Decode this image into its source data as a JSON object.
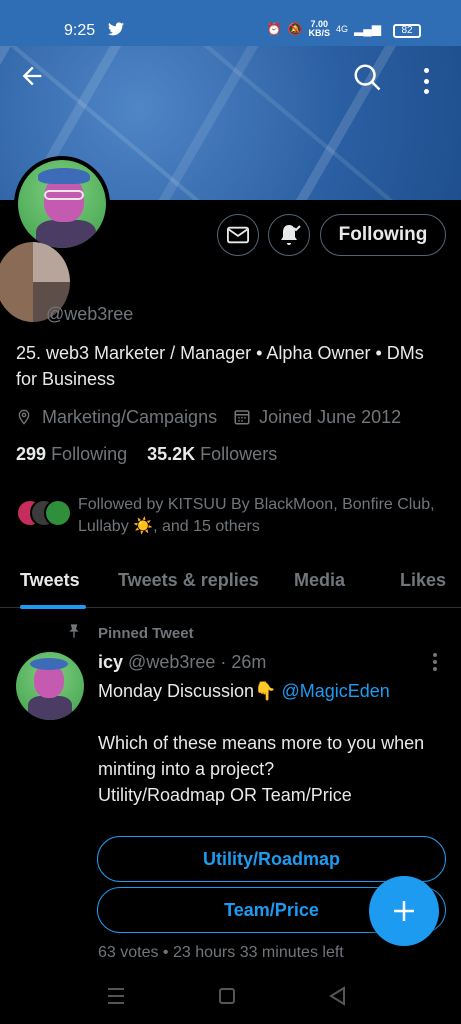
{
  "status_bar": {
    "time": "9:25",
    "speed_top": "7.00",
    "speed_bottom": "KB/S",
    "network": "4G",
    "battery": "82"
  },
  "profile": {
    "handle": "@web3ree",
    "bio": "25. web3 Marketer / Manager • Alpha Owner • DMs for Business",
    "location": "Marketing/Campaigns",
    "joined": "Joined June 2012",
    "following_count": "299",
    "following_label": "Following",
    "followers_count": "35.2K",
    "followers_label": "Followers",
    "followed_by": "Followed by KITSUU By BlackMoon, Bonfire Club, Lullaby ☀️, and 15 others"
  },
  "actions": {
    "following_button": "Following"
  },
  "tabs": [
    {
      "label": "Tweets",
      "active": true
    },
    {
      "label": "Tweets & replies",
      "active": false
    },
    {
      "label": "Media",
      "active": false
    },
    {
      "label": "Likes",
      "active": false
    }
  ],
  "tweet": {
    "pinned_label": "Pinned Tweet",
    "name": "icy",
    "handle_time": "@web3ree · 26m",
    "line1": "Monday Discussion👇 ",
    "mention": "@MagicEden",
    "line2": "Which of these means more to you when minting into a project?",
    "line3": "Utility/Roadmap OR Team/Price",
    "poll_options": [
      "Utility/Roadmap",
      "Team/Price"
    ],
    "poll_meta": "63 votes • 23 hours 33 minutes left"
  },
  "colors": {
    "accent": "#1d9bf0",
    "background": "#000000",
    "status_bar": "#2f6db5"
  }
}
